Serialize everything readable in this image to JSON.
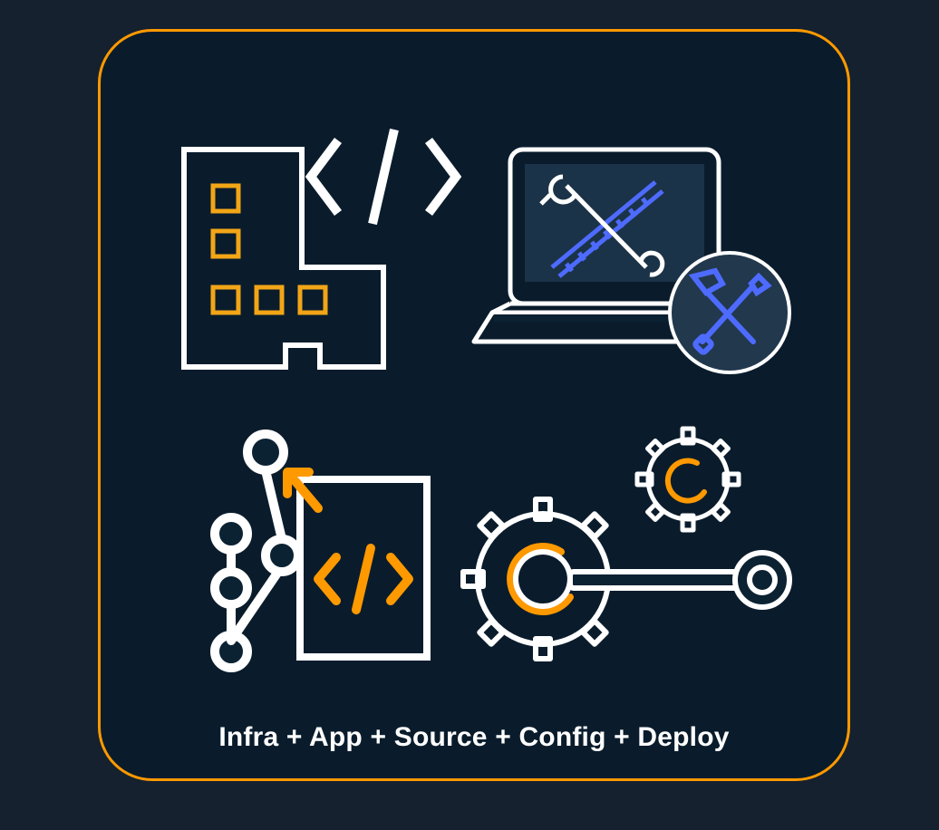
{
  "colors": {
    "background": "#15212e",
    "panel": "#0b2233",
    "border": "#ff9900",
    "stroke_light": "#ffffff",
    "accent_amber": "#f2a516",
    "accent_orange": "#ff9900",
    "accent_blue": "#4e6bff"
  },
  "icons": {
    "top_left": "building-code-icon",
    "top_right": "laptop-tools-icon",
    "bottom_left": "git-branch-code-icon",
    "bottom_right": "gears-wrench-icon"
  },
  "caption": "Infra + App + Source + Config + Deploy"
}
